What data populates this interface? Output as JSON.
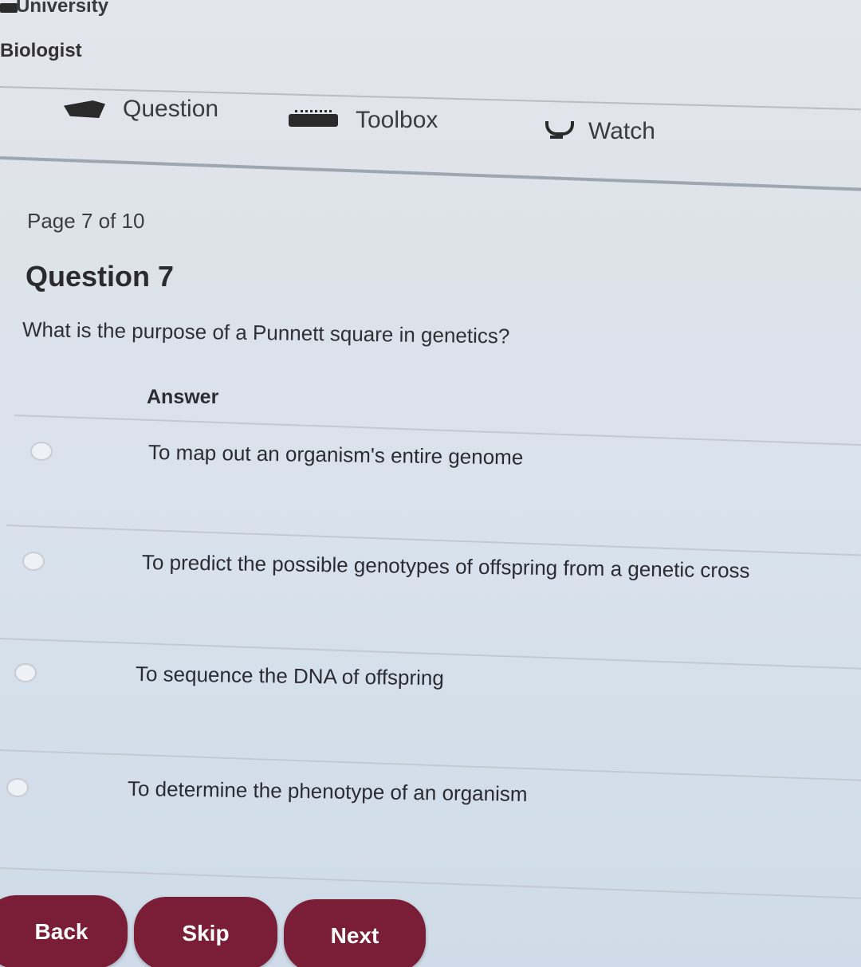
{
  "header": {
    "brand": "University",
    "role": "Biologist"
  },
  "nav": {
    "items": [
      {
        "label": "Question",
        "icon": "chat-icon"
      },
      {
        "label": "Toolbox",
        "icon": "toolbox-icon"
      },
      {
        "label": "Watch",
        "icon": "watch-icon"
      }
    ]
  },
  "quiz": {
    "page_indicator": "Page 7 of 10",
    "title": "Question 7",
    "prompt": "What is the purpose of a Punnett square in genetics?",
    "answer_label": "Answer",
    "options": [
      "To map out an organism's entire genome",
      "To predict the possible genotypes of offspring from a genetic cross",
      "To sequence the DNA of offspring",
      "To determine the phenotype of an organism"
    ]
  },
  "footer": {
    "back_label": "Back",
    "skip_label": "Skip",
    "next_label": "Next"
  },
  "colors": {
    "button": "#7a1e37",
    "button_text": "#ffffff",
    "background": "#d9e2ec"
  }
}
